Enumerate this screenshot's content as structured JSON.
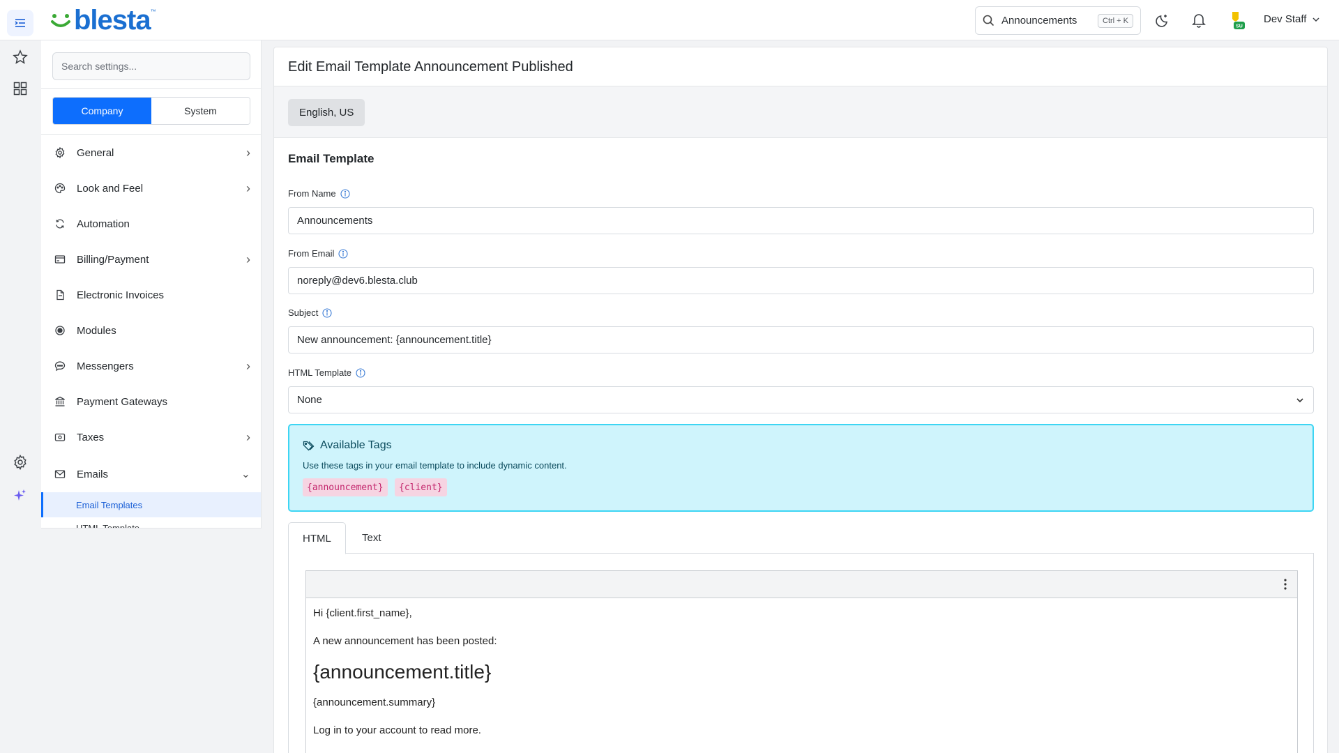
{
  "app": {
    "logo_text": "blesta",
    "logo_tm": "™",
    "brand_color": "#1a6fd1",
    "accent_color": "#0d6efd"
  },
  "topbar": {
    "search_value": "Announcements",
    "search_shortcut": "Ctrl + K",
    "user_name": "Dev Staff",
    "avatar_badge": "SU",
    "icons": [
      "sidebar-toggle-icon",
      "search-icon",
      "moon-icon",
      "bell-icon",
      "shield-icon",
      "chevron-down-icon"
    ]
  },
  "rail": {
    "icons": [
      "favorites-star-icon",
      "apps-grid-icon",
      "settings-gear-icon",
      "sparkle-icon"
    ]
  },
  "sidebar": {
    "search_placeholder": "Search settings...",
    "segments": [
      "Company",
      "System"
    ],
    "items": [
      {
        "label": "General",
        "icon": "gear-icon",
        "chevron": "›"
      },
      {
        "label": "Look and Feel",
        "icon": "palette-icon",
        "chevron": "›"
      },
      {
        "label": "Automation",
        "icon": "refresh-icon",
        "chevron": ""
      },
      {
        "label": "Billing/Payment",
        "icon": "credit-card-icon",
        "chevron": "›"
      },
      {
        "label": "Electronic Invoices",
        "icon": "file-icon",
        "chevron": ""
      },
      {
        "label": "Modules",
        "icon": "modules-icon",
        "chevron": ""
      },
      {
        "label": "Messengers",
        "icon": "chat-icon",
        "chevron": "›"
      },
      {
        "label": "Payment Gateways",
        "icon": "bank-icon",
        "chevron": ""
      },
      {
        "label": "Taxes",
        "icon": "cash-icon",
        "chevron": "›"
      },
      {
        "label": "Emails",
        "icon": "envelope-icon",
        "chevron": "⌄"
      }
    ],
    "subitems": [
      "Email Templates",
      "HTML Template"
    ]
  },
  "main": {
    "title": "Edit Email Template Announcement Published",
    "language": "English, US",
    "section_title": "Email Template",
    "fields": {
      "from_name": {
        "label": "From Name",
        "value": "Announcements"
      },
      "from_email": {
        "label": "From Email",
        "value": "noreply@dev6.blesta.club"
      },
      "subject": {
        "label": "Subject",
        "value": "New announcement: {announcement.title}"
      },
      "html_template": {
        "label": "HTML Template",
        "value": "None"
      }
    },
    "available_tags": {
      "title": "Available Tags",
      "description": "Use these tags in your email template to include dynamic content.",
      "tags": [
        "{announcement}",
        "{client}"
      ]
    },
    "tabs": [
      "HTML",
      "Text"
    ],
    "editor": {
      "lines": [
        "Hi {client.first_name},",
        "A new announcement has been posted:",
        "{announcement.title}",
        "{announcement.summary}",
        "Log in to your account to read more."
      ]
    }
  }
}
